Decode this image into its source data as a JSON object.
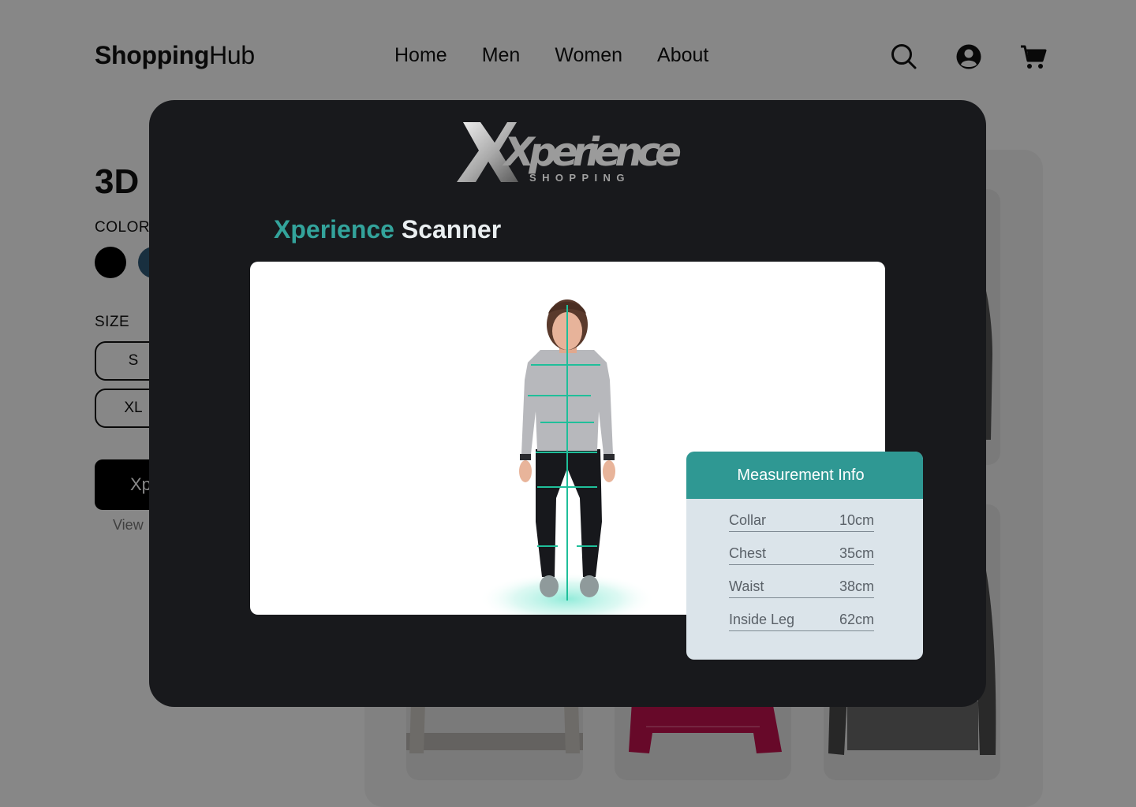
{
  "header": {
    "logo_bold": "Shopping",
    "logo_light": "Hub",
    "nav": [
      "Home",
      "Men",
      "Women",
      "About"
    ],
    "icons": [
      "search-icon",
      "account-icon",
      "cart-icon"
    ]
  },
  "product": {
    "title_visible": "3D",
    "color_label": "COLOR",
    "colors": [
      "#000000",
      "#2f5a78"
    ],
    "size_label": "SIZE",
    "sizes": [
      "S",
      "XL"
    ],
    "cta_partial": "Xp",
    "view_link_partial": "View"
  },
  "modal": {
    "brand_primary": "Xperience",
    "brand_secondary": "SHOPPING",
    "title_accent": "Xperience",
    "title_rest": "Scanner",
    "measurements": {
      "heading": "Measurement Info",
      "rows": [
        {
          "label": "Collar",
          "value": "10cm"
        },
        {
          "label": "Chest",
          "value": "35cm"
        },
        {
          "label": "Waist",
          "value": "38cm"
        },
        {
          "label": "Inside Leg",
          "value": "62cm"
        }
      ]
    }
  },
  "colors": {
    "accent": "#33a39b",
    "modal_bg": "#18191c",
    "scan_line": "#1fbf9a"
  }
}
